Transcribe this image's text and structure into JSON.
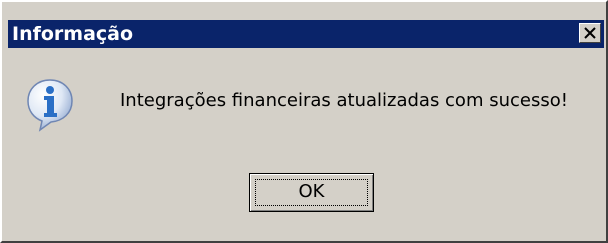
{
  "dialog": {
    "title": "Informação",
    "close_icon": "close-icon",
    "icon": "information-icon",
    "message": "Integrações financeiras atualizadas com sucesso!",
    "ok_label": "OK"
  },
  "colors": {
    "titlebar": "#0a246a",
    "face": "#d4d0c8",
    "icon_blue": "#2a6fc6"
  }
}
